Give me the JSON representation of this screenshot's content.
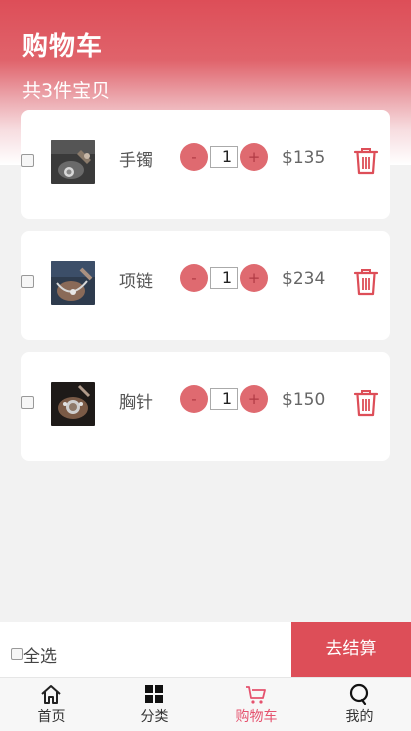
{
  "header": {
    "title": "购物车",
    "count_text": "共3件宝贝"
  },
  "cart": {
    "items": [
      {
        "name": "手镯",
        "quantity": "1",
        "price": "$135",
        "minus_label": "-",
        "plus_label": "+",
        "thumb_icon": "bracelet-photo"
      },
      {
        "name": "项链",
        "quantity": "1",
        "price": "$234",
        "minus_label": "-",
        "plus_label": "+",
        "thumb_icon": "necklace-photo"
      },
      {
        "name": "胸针",
        "quantity": "1",
        "price": "$150",
        "minus_label": "-",
        "plus_label": "+",
        "thumb_icon": "brooch-photo"
      }
    ]
  },
  "footer": {
    "select_all_label": "全选",
    "checkout_label": "去结算"
  },
  "tabbar": {
    "tabs": [
      {
        "label": "首页",
        "icon": "home-icon",
        "active": false
      },
      {
        "label": "分类",
        "icon": "grid-icon",
        "active": false
      },
      {
        "label": "购物车",
        "icon": "cart-icon",
        "active": true
      },
      {
        "label": "我的",
        "icon": "profile-icon",
        "active": false
      }
    ]
  },
  "colors": {
    "accent": "#dd4e58",
    "active_tab": "#e5526e",
    "stepper": "#df6a70"
  }
}
